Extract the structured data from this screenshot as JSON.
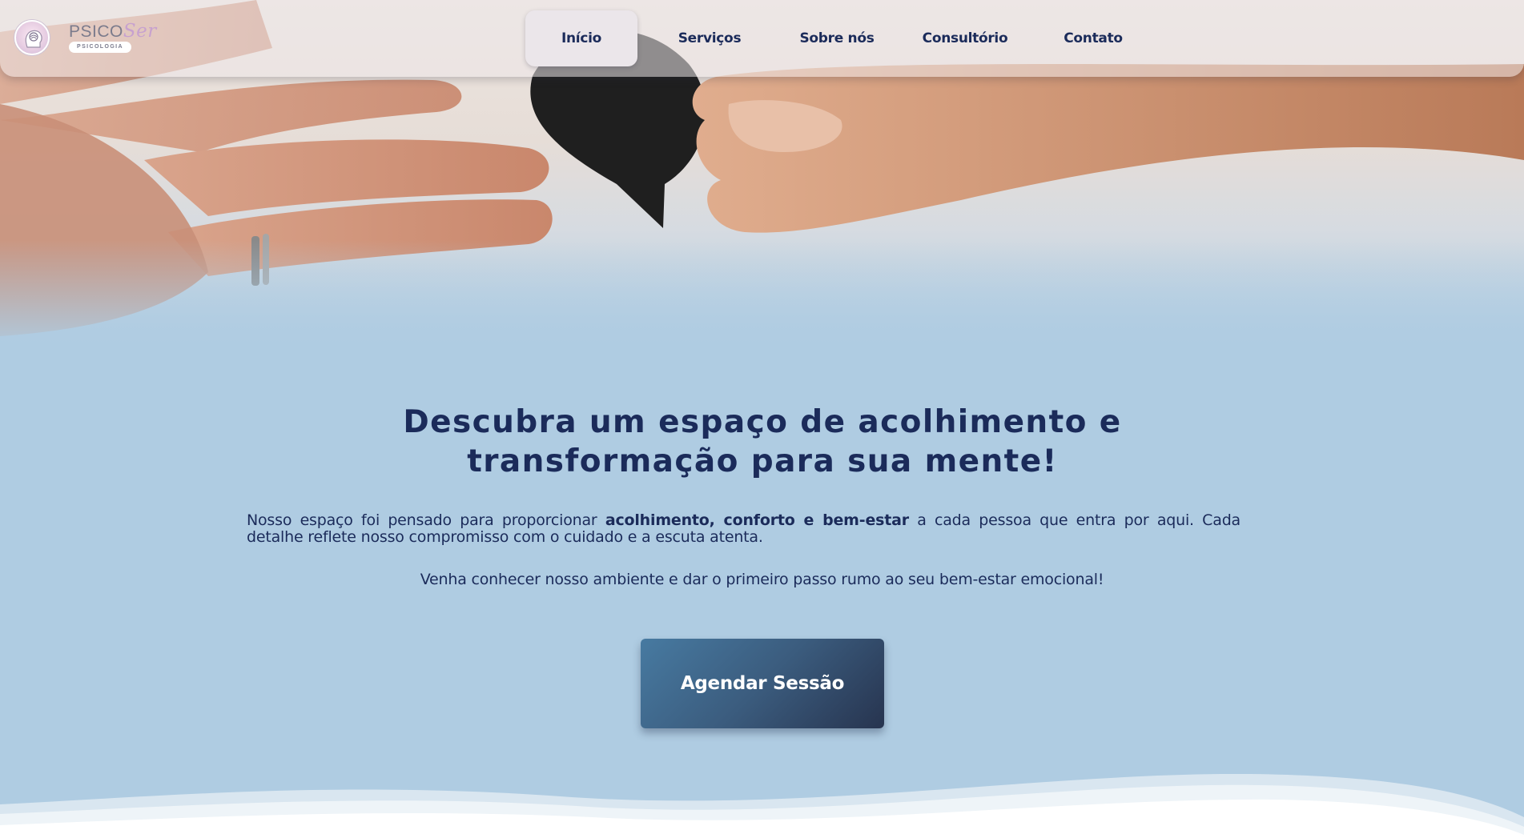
{
  "brand": {
    "name_prefix": "PSICO",
    "name_suffix": "Ser",
    "tagline": "PSICOLOGIA"
  },
  "nav": {
    "items": [
      {
        "label": "Início",
        "active": true
      },
      {
        "label": "Serviços",
        "active": false
      },
      {
        "label": "Sobre nós",
        "active": false
      },
      {
        "label": "Consultório",
        "active": false
      },
      {
        "label": "Contato",
        "active": false
      }
    ]
  },
  "hero": {
    "headline_line1": "Descubra um espaço de acolhimento e",
    "headline_line2": "transformação para sua mente!",
    "intro_before": "Nosso espaço foi pensado para proporcionar ",
    "intro_bold": "acolhimento, conforto e bem-estar",
    "intro_after": " a cada pessoa que entra por aqui. Cada detalhe reflete nosso compromisso com o cuidado e a escuta atenta.",
    "invite": "Venha conhecer nosso ambiente e dar o primeiro passo rumo ao seu bem-estar emocional!",
    "cta_label": "Agendar Sessão"
  },
  "colors": {
    "background": "#afcce2",
    "text": "#1b2b5a",
    "button_start": "#477aa1",
    "button_end": "#27344f",
    "logo_accent": "#c7a1cf"
  },
  "icons": {
    "logo": "head-brain-icon"
  }
}
